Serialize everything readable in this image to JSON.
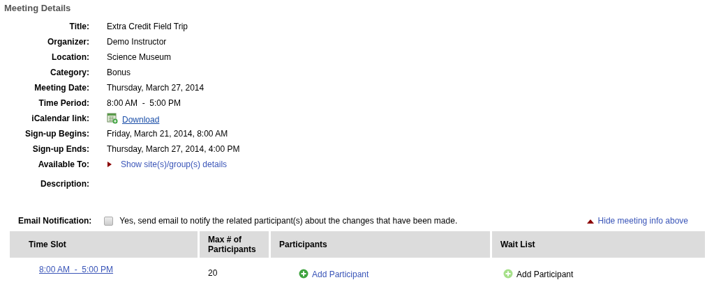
{
  "section_title": "Meeting Details",
  "details": [
    {
      "label": "Title:",
      "kind": "text",
      "value": "Extra Credit Field Trip"
    },
    {
      "label": "Organizer:",
      "kind": "text",
      "value": "Demo Instructor"
    },
    {
      "label": "Location:",
      "kind": "text",
      "value": "Science Museum"
    },
    {
      "label": "Category:",
      "kind": "text",
      "value": "Bonus"
    },
    {
      "label": "Meeting Date:",
      "kind": "text",
      "value": "Thursday, March 27, 2014"
    },
    {
      "label": "Time Period:",
      "kind": "text",
      "value": "8:00 AM  -  5:00 PM"
    },
    {
      "label": "iCalendar link:",
      "kind": "download",
      "value": "Download"
    },
    {
      "label": "Sign-up Begins:",
      "kind": "text",
      "value": "Friday, March 21, 2014, 8:00 AM"
    },
    {
      "label": "Sign-up Ends:",
      "kind": "text",
      "value": "Thursday, March 27, 2014, 4:00 PM"
    },
    {
      "label": "Available To:",
      "kind": "toggle",
      "value": "Show site(s)/group(s) details",
      "expanded": false
    },
    {
      "label": "Description:",
      "kind": "text"
    }
  ],
  "email_notification": {
    "label": "Email Notification:",
    "checked": false,
    "text": "Yes, send email to notify the related participant(s) about the changes that have been made."
  },
  "hide_link": {
    "label": "Hide meeting info above",
    "expanded": true
  },
  "table": {
    "columns": [
      "Time Slot",
      "Max # of Participants",
      "Participants",
      "Wait List"
    ],
    "rows": [
      {
        "time_slot": "8:00 AM  -  5:00 PM",
        "max": "20",
        "participants": {
          "label": "Add Participant",
          "enabled": true
        },
        "wait_list": {
          "label": "Add Participant",
          "enabled": false
        }
      }
    ]
  }
}
